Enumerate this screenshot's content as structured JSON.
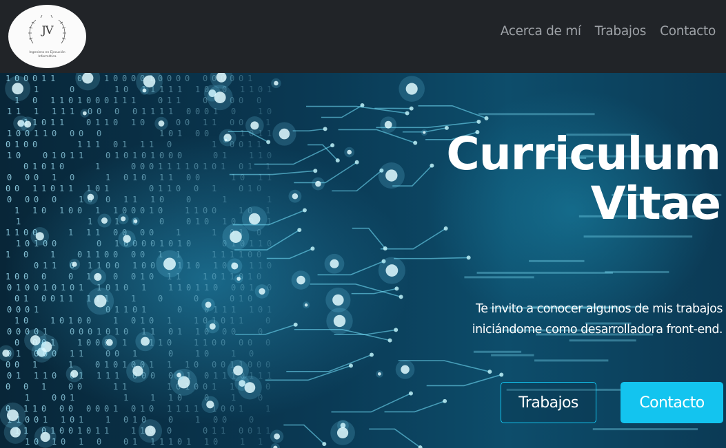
{
  "navbar": {
    "logo": {
      "monogram": "JV",
      "caption_line1": "Ingeniera en Ejecución",
      "caption_line2": "Informática"
    },
    "links": [
      {
        "label": "Acerca de mí"
      },
      {
        "label": "Trabajos"
      },
      {
        "label": "Contacto"
      }
    ]
  },
  "hero": {
    "title": "Curriculum\nVitae",
    "subtitle_line1": "Te invito a conocer algunos de mis trabajos",
    "subtitle_line2": "iniciándome como desarrolladora front-end.",
    "buttons": {
      "outline_label": "Trabajos",
      "solid_label": "Contacto"
    }
  },
  "colors": {
    "navbar_bg": "#212428",
    "nav_link": "#9ea2a7",
    "accent": "#13c4ef",
    "hero_text": "#ffffff"
  }
}
